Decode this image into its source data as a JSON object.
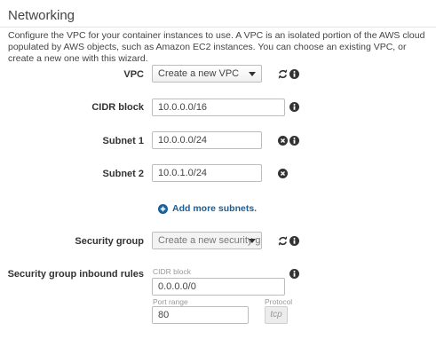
{
  "section": {
    "title": "Networking",
    "description": "Configure the VPC for your container instances to use. A VPC is an isolated portion of the AWS cloud populated by AWS objects, such as Amazon EC2 instances. You can choose an existing VPC, or create a new one with this wizard."
  },
  "form": {
    "vpc": {
      "label": "VPC",
      "value": "Create a new VPC"
    },
    "cidr": {
      "label": "CIDR block",
      "value": "10.0.0.0/16"
    },
    "subnet1": {
      "label": "Subnet 1",
      "value": "10.0.0.0/24"
    },
    "subnet2": {
      "label": "Subnet 2",
      "value": "10.0.1.0/24"
    },
    "add_subnets": "Add more subnets.",
    "security_group": {
      "label": "Security group",
      "value": "Create a new security g..."
    },
    "inbound": {
      "label": "Security group inbound rules",
      "cidr_label": "CIDR block",
      "cidr_value": "0.0.0.0/0",
      "port_label": "Port range",
      "port_value": "80",
      "protocol_label": "Protocol",
      "protocol_value": "tcp"
    }
  },
  "icons": {
    "refresh": "refresh-icon",
    "info": "info-icon",
    "remove": "remove-icon",
    "add": "plus-circle-icon"
  }
}
